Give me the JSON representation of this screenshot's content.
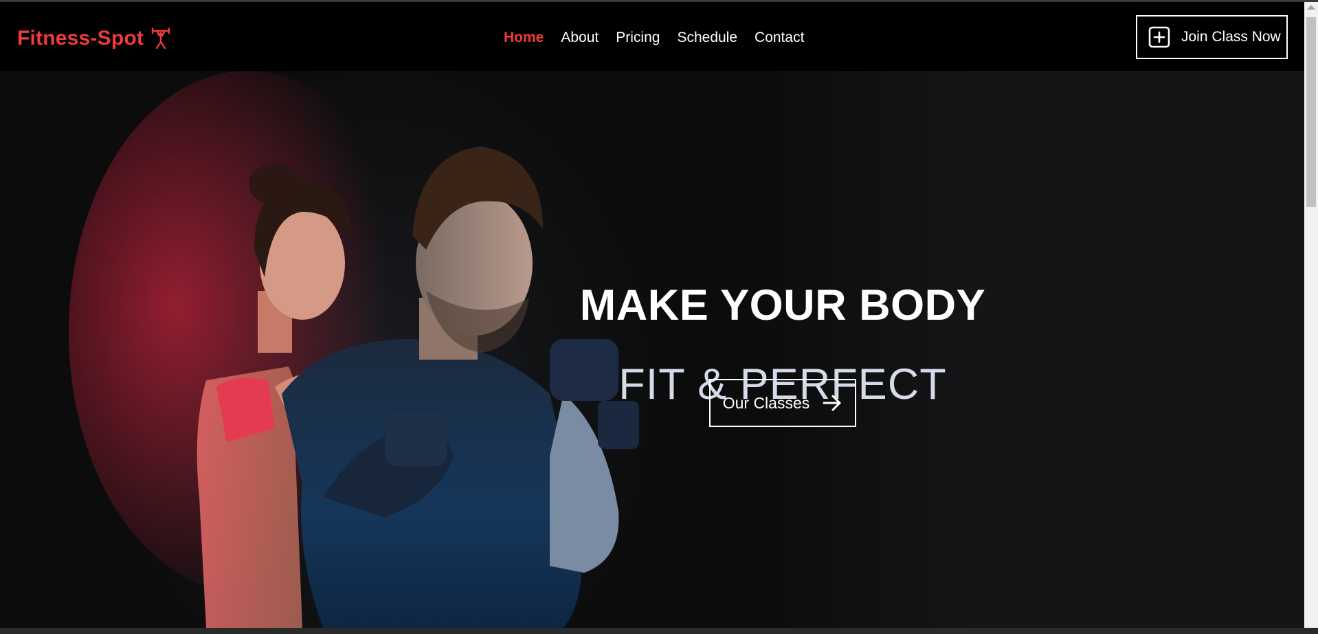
{
  "navbar": {
    "brand": "Fitness-Spot",
    "brand_icon": "weightlifter-icon",
    "links": [
      {
        "label": "Home",
        "active": true
      },
      {
        "label": "About",
        "active": false
      },
      {
        "label": "Pricing",
        "active": false
      },
      {
        "label": "Schedule",
        "active": false
      },
      {
        "label": "Contact",
        "active": false
      }
    ],
    "cta_label": "Join Class Now",
    "cta_icon": "plus-square-icon"
  },
  "hero": {
    "headline": "MAKE YOUR BODY",
    "subheadline": "FIT & PERFECT",
    "button_label": "Our Classes",
    "button_icon": "arrow-right-icon",
    "image_subject": "hero-photo"
  },
  "colors": {
    "brand_red": "#ef3b3b",
    "navbar_bg": "#000000",
    "hero_bg": "#0e0e0f",
    "subheadline": "#d5dbe8",
    "text_white": "#ffffff"
  }
}
